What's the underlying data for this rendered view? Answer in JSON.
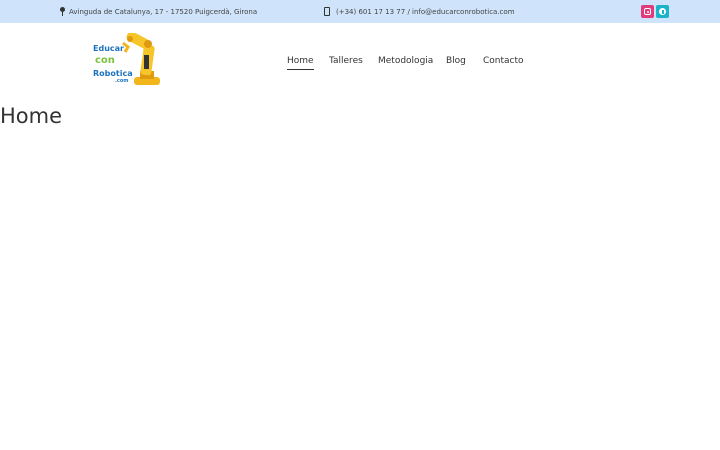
{
  "topbar": {
    "address": "Avinguda de Catalunya, 17 - 17520 Puigcerdà, Girona",
    "contact": "(+34) 601 17 13 77 / info@educarconrobotica.com",
    "bg_color": "#cfe3fa",
    "social": [
      {
        "icon": "instagram-icon",
        "color": "#e03c7c"
      },
      {
        "icon": "facebook-icon",
        "color": "#1ab3c7"
      }
    ]
  },
  "logo": {
    "line1": "Educar",
    "line2": "con",
    "line3": "Robotica",
    "line4": ".com"
  },
  "nav": {
    "items": [
      {
        "label": "Home",
        "active": true
      },
      {
        "label": "Talleres"
      },
      {
        "label": "Metodologia"
      },
      {
        "label": "Blog"
      },
      {
        "label": "Contacto"
      }
    ]
  },
  "page": {
    "title": "Home"
  }
}
